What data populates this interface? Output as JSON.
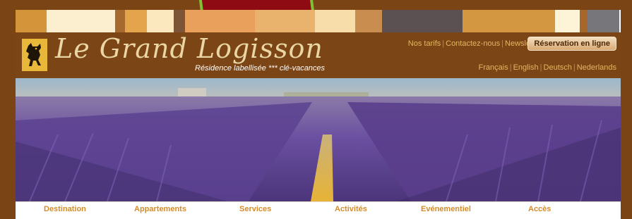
{
  "brand": {
    "name": "Le Grand Logisson",
    "tagline": "Résidence labellisée *** clé-vacances"
  },
  "top_links": [
    "Nos tarifs",
    "Contactez-nous",
    "Newsletter"
  ],
  "reservation_button": "Réservation en ligne",
  "languages": [
    "Français",
    "English",
    "Deutsch",
    "Nederlands"
  ],
  "nav": [
    "Destination",
    "Appartements",
    "Services",
    "Activités",
    "Evénementiel",
    "Accès"
  ],
  "colors": {
    "page_background": "#7a4414",
    "header_background": "#7b4515",
    "link": "#e3b763",
    "nav_text": "#d58b28",
    "lavender": "#6a4fa0",
    "badge_red": "#8e0b14",
    "badge_border": "#7ec132"
  },
  "icons": {
    "logo": "dog-heraldic-icon"
  }
}
